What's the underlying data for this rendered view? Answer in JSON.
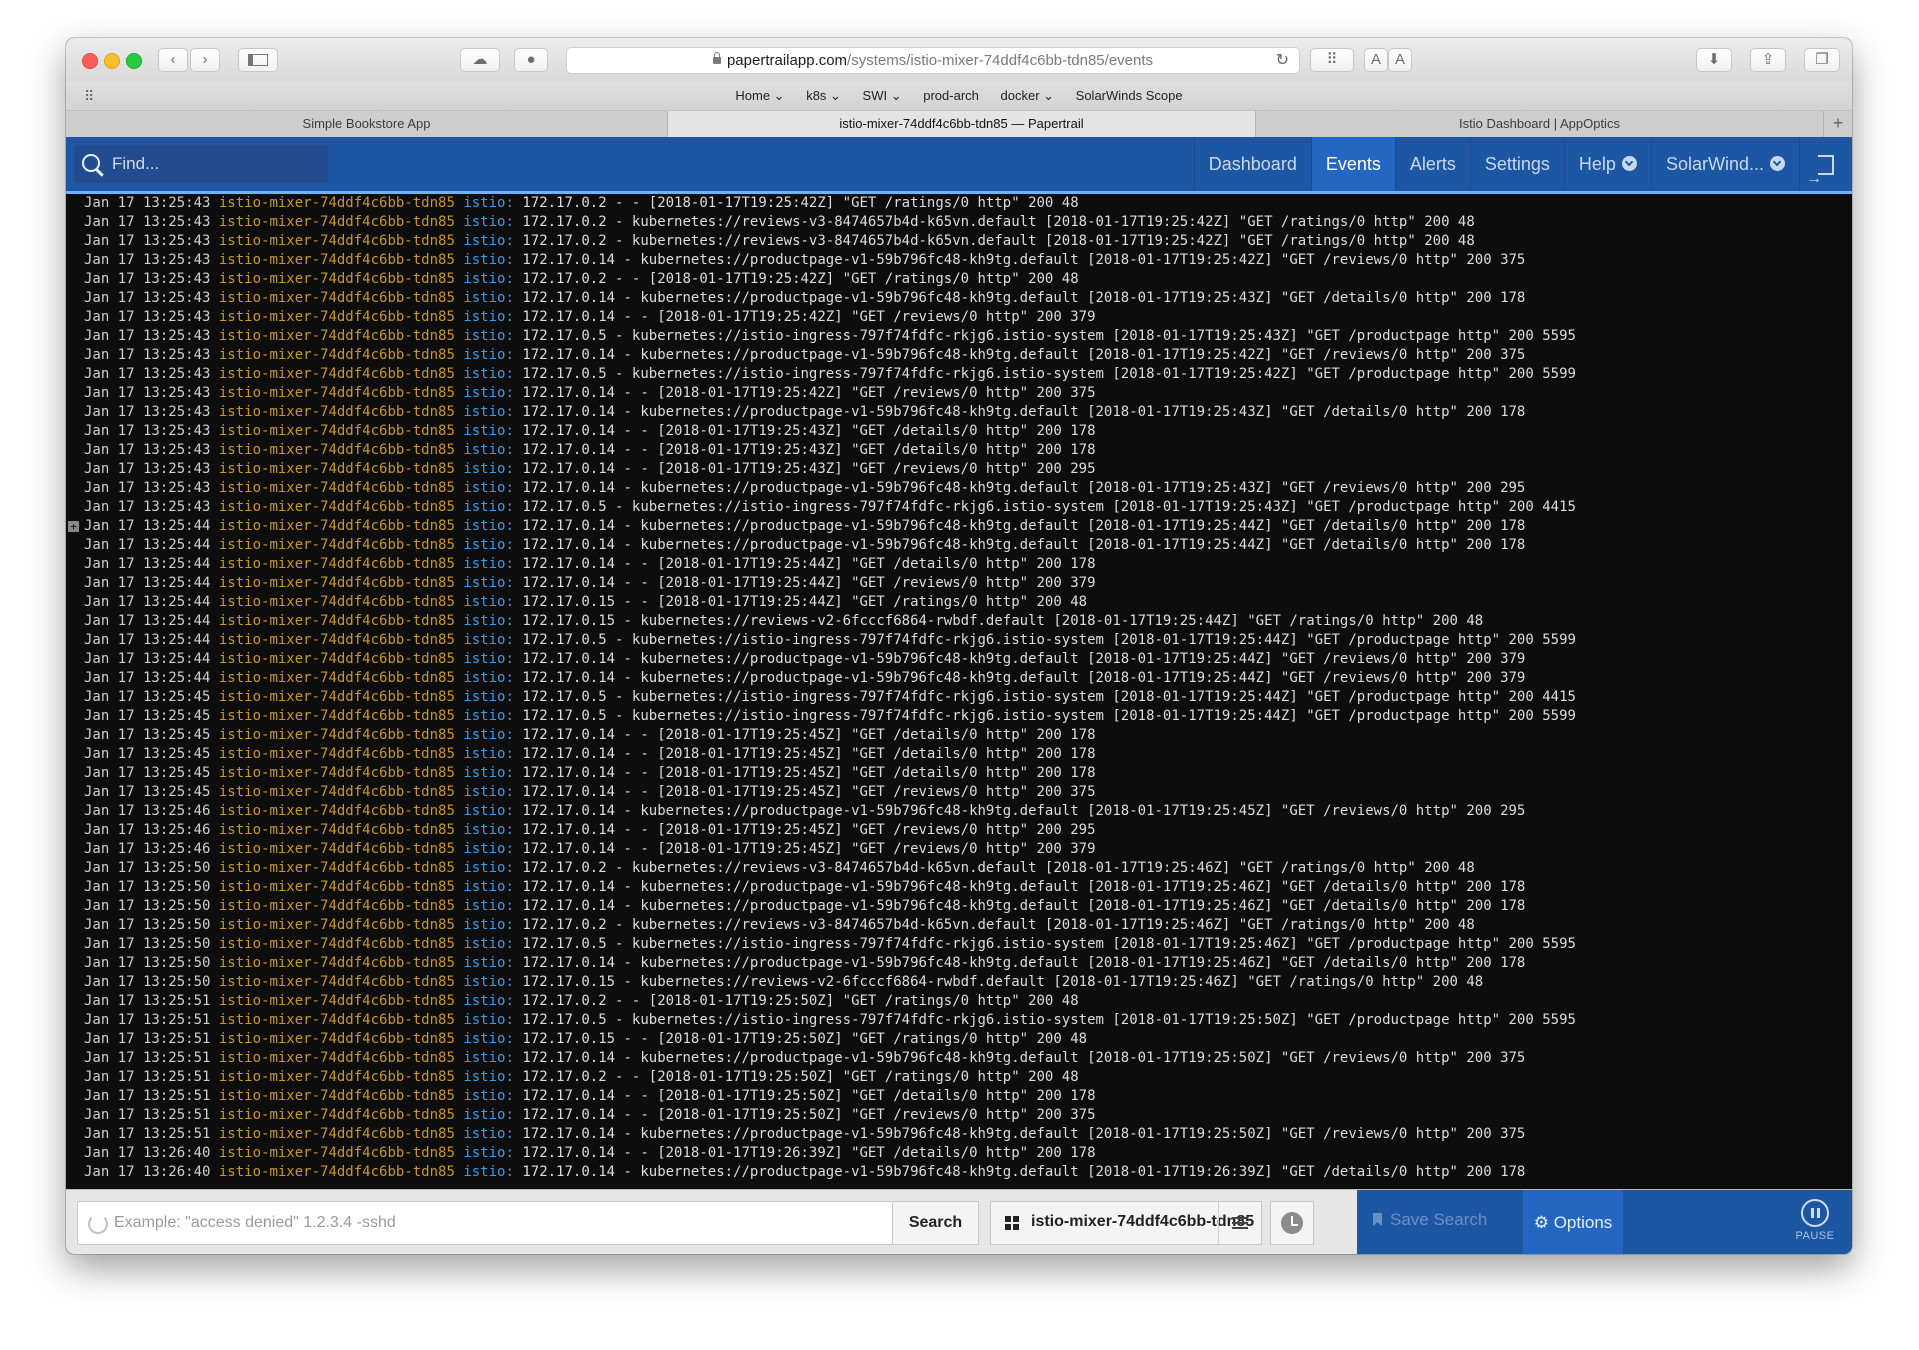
{
  "browser": {
    "url_host": "papertrailapp.com",
    "url_path": "/systems/istio-mixer-74ddf4c6bb-tdn85/events",
    "text_size_small": "A",
    "text_size_large": "A",
    "favorites": [
      "Home ⌄",
      "k8s ⌄",
      "SWI ⌄",
      "prod-arch",
      "docker ⌄",
      "SolarWinds Scope"
    ],
    "tabs": [
      {
        "title": "Simple Bookstore App",
        "active": false
      },
      {
        "title": "istio-mixer-74ddf4c6bb-tdn85 — Papertrail",
        "active": true
      },
      {
        "title": "Istio Dashboard | AppOptics",
        "active": false
      }
    ]
  },
  "nav": {
    "find_placeholder": "Find...",
    "items": [
      {
        "label": "Dashboard",
        "active": false
      },
      {
        "label": "Events",
        "active": true
      },
      {
        "label": "Alerts",
        "active": false
      },
      {
        "label": "Settings",
        "active": false
      },
      {
        "label": "Help",
        "active": false
      },
      {
        "label": "SolarWind...",
        "active": false
      }
    ]
  },
  "log": {
    "source": "istio-mixer-74ddf4c6bb-tdn85",
    "program": "istio:",
    "lines": [
      {
        "ts": "Jan 17 13:25:43",
        "msg": "172.17.0.2 - - [2018-01-17T19:25:42Z] \"GET /ratings/0 http\" 200 48"
      },
      {
        "ts": "Jan 17 13:25:43",
        "msg": "172.17.0.2 - kubernetes://reviews-v3-8474657b4d-k65vn.default [2018-01-17T19:25:42Z] \"GET /ratings/0 http\" 200 48"
      },
      {
        "ts": "Jan 17 13:25:43",
        "msg": "172.17.0.2 - kubernetes://reviews-v3-8474657b4d-k65vn.default [2018-01-17T19:25:42Z] \"GET /ratings/0 http\" 200 48"
      },
      {
        "ts": "Jan 17 13:25:43",
        "msg": "172.17.0.14 - kubernetes://productpage-v1-59b796fc48-kh9tg.default [2018-01-17T19:25:42Z] \"GET /reviews/0 http\" 200 375"
      },
      {
        "ts": "Jan 17 13:25:43",
        "msg": "172.17.0.2 - - [2018-01-17T19:25:42Z] \"GET /ratings/0 http\" 200 48"
      },
      {
        "ts": "Jan 17 13:25:43",
        "msg": "172.17.0.14 - kubernetes://productpage-v1-59b796fc48-kh9tg.default [2018-01-17T19:25:43Z] \"GET /details/0 http\" 200 178"
      },
      {
        "ts": "Jan 17 13:25:43",
        "msg": "172.17.0.14 - - [2018-01-17T19:25:42Z] \"GET /reviews/0 http\" 200 379"
      },
      {
        "ts": "Jan 17 13:25:43",
        "msg": "172.17.0.5 - kubernetes://istio-ingress-797f74fdfc-rkjg6.istio-system [2018-01-17T19:25:43Z] \"GET /productpage http\" 200 5595"
      },
      {
        "ts": "Jan 17 13:25:43",
        "msg": "172.17.0.14 - kubernetes://productpage-v1-59b796fc48-kh9tg.default [2018-01-17T19:25:42Z] \"GET /reviews/0 http\" 200 375"
      },
      {
        "ts": "Jan 17 13:25:43",
        "msg": "172.17.0.5 - kubernetes://istio-ingress-797f74fdfc-rkjg6.istio-system [2018-01-17T19:25:42Z] \"GET /productpage http\" 200 5599"
      },
      {
        "ts": "Jan 17 13:25:43",
        "msg": "172.17.0.14 - - [2018-01-17T19:25:42Z] \"GET /reviews/0 http\" 200 375"
      },
      {
        "ts": "Jan 17 13:25:43",
        "msg": "172.17.0.14 - kubernetes://productpage-v1-59b796fc48-kh9tg.default [2018-01-17T19:25:43Z] \"GET /details/0 http\" 200 178"
      },
      {
        "ts": "Jan 17 13:25:43",
        "msg": "172.17.0.14 - - [2018-01-17T19:25:43Z] \"GET /details/0 http\" 200 178"
      },
      {
        "ts": "Jan 17 13:25:43",
        "msg": "172.17.0.14 - - [2018-01-17T19:25:43Z] \"GET /details/0 http\" 200 178"
      },
      {
        "ts": "Jan 17 13:25:43",
        "msg": "172.17.0.14 - - [2018-01-17T19:25:43Z] \"GET /reviews/0 http\" 200 295"
      },
      {
        "ts": "Jan 17 13:25:43",
        "msg": "172.17.0.14 - kubernetes://productpage-v1-59b796fc48-kh9tg.default [2018-01-17T19:25:43Z] \"GET /reviews/0 http\" 200 295"
      },
      {
        "ts": "Jan 17 13:25:43",
        "msg": "172.17.0.5 - kubernetes://istio-ingress-797f74fdfc-rkjg6.istio-system [2018-01-17T19:25:43Z] \"GET /productpage http\" 200 4415"
      },
      {
        "ts": "Jan 17 13:25:44",
        "msg": "172.17.0.14 - kubernetes://productpage-v1-59b796fc48-kh9tg.default [2018-01-17T19:25:44Z] \"GET /details/0 http\" 200 178",
        "marker": "+"
      },
      {
        "ts": "Jan 17 13:25:44",
        "msg": "172.17.0.14 - kubernetes://productpage-v1-59b796fc48-kh9tg.default [2018-01-17T19:25:44Z] \"GET /details/0 http\" 200 178"
      },
      {
        "ts": "Jan 17 13:25:44",
        "msg": "172.17.0.14 - - [2018-01-17T19:25:44Z] \"GET /details/0 http\" 200 178"
      },
      {
        "ts": "Jan 17 13:25:44",
        "msg": "172.17.0.14 - - [2018-01-17T19:25:44Z] \"GET /reviews/0 http\" 200 379"
      },
      {
        "ts": "Jan 17 13:25:44",
        "msg": "172.17.0.15 - - [2018-01-17T19:25:44Z] \"GET /ratings/0 http\" 200 48"
      },
      {
        "ts": "Jan 17 13:25:44",
        "msg": "172.17.0.15 - kubernetes://reviews-v2-6fcccf6864-rwbdf.default [2018-01-17T19:25:44Z] \"GET /ratings/0 http\" 200 48"
      },
      {
        "ts": "Jan 17 13:25:44",
        "msg": "172.17.0.5 - kubernetes://istio-ingress-797f74fdfc-rkjg6.istio-system [2018-01-17T19:25:44Z] \"GET /productpage http\" 200 5599"
      },
      {
        "ts": "Jan 17 13:25:44",
        "msg": "172.17.0.14 - kubernetes://productpage-v1-59b796fc48-kh9tg.default [2018-01-17T19:25:44Z] \"GET /reviews/0 http\" 200 379"
      },
      {
        "ts": "Jan 17 13:25:44",
        "msg": "172.17.0.14 - kubernetes://productpage-v1-59b796fc48-kh9tg.default [2018-01-17T19:25:44Z] \"GET /reviews/0 http\" 200 379"
      },
      {
        "ts": "Jan 17 13:25:45",
        "msg": "172.17.0.5 - kubernetes://istio-ingress-797f74fdfc-rkjg6.istio-system [2018-01-17T19:25:44Z] \"GET /productpage http\" 200 4415"
      },
      {
        "ts": "Jan 17 13:25:45",
        "msg": "172.17.0.5 - kubernetes://istio-ingress-797f74fdfc-rkjg6.istio-system [2018-01-17T19:25:44Z] \"GET /productpage http\" 200 5599"
      },
      {
        "ts": "Jan 17 13:25:45",
        "msg": "172.17.0.14 - - [2018-01-17T19:25:45Z] \"GET /details/0 http\" 200 178"
      },
      {
        "ts": "Jan 17 13:25:45",
        "msg": "172.17.0.14 - - [2018-01-17T19:25:45Z] \"GET /details/0 http\" 200 178"
      },
      {
        "ts": "Jan 17 13:25:45",
        "msg": "172.17.0.14 - - [2018-01-17T19:25:45Z] \"GET /details/0 http\" 200 178"
      },
      {
        "ts": "Jan 17 13:25:45",
        "msg": "172.17.0.14 - - [2018-01-17T19:25:45Z] \"GET /reviews/0 http\" 200 375"
      },
      {
        "ts": "Jan 17 13:25:46",
        "msg": "172.17.0.14 - kubernetes://productpage-v1-59b796fc48-kh9tg.default [2018-01-17T19:25:45Z] \"GET /reviews/0 http\" 200 295"
      },
      {
        "ts": "Jan 17 13:25:46",
        "msg": "172.17.0.14 - - [2018-01-17T19:25:45Z] \"GET /reviews/0 http\" 200 295"
      },
      {
        "ts": "Jan 17 13:25:46",
        "msg": "172.17.0.14 - - [2018-01-17T19:25:45Z] \"GET /reviews/0 http\" 200 379"
      },
      {
        "ts": "Jan 17 13:25:50",
        "msg": "172.17.0.2 - kubernetes://reviews-v3-8474657b4d-k65vn.default [2018-01-17T19:25:46Z] \"GET /ratings/0 http\" 200 48"
      },
      {
        "ts": "Jan 17 13:25:50",
        "msg": "172.17.0.14 - kubernetes://productpage-v1-59b796fc48-kh9tg.default [2018-01-17T19:25:46Z] \"GET /details/0 http\" 200 178"
      },
      {
        "ts": "Jan 17 13:25:50",
        "msg": "172.17.0.14 - kubernetes://productpage-v1-59b796fc48-kh9tg.default [2018-01-17T19:25:46Z] \"GET /details/0 http\" 200 178"
      },
      {
        "ts": "Jan 17 13:25:50",
        "msg": "172.17.0.2 - kubernetes://reviews-v3-8474657b4d-k65vn.default [2018-01-17T19:25:46Z] \"GET /ratings/0 http\" 200 48"
      },
      {
        "ts": "Jan 17 13:25:50",
        "msg": "172.17.0.5 - kubernetes://istio-ingress-797f74fdfc-rkjg6.istio-system [2018-01-17T19:25:46Z] \"GET /productpage http\" 200 5595"
      },
      {
        "ts": "Jan 17 13:25:50",
        "msg": "172.17.0.14 - kubernetes://productpage-v1-59b796fc48-kh9tg.default [2018-01-17T19:25:46Z] \"GET /details/0 http\" 200 178"
      },
      {
        "ts": "Jan 17 13:25:50",
        "msg": "172.17.0.15 - kubernetes://reviews-v2-6fcccf6864-rwbdf.default [2018-01-17T19:25:46Z] \"GET /ratings/0 http\" 200 48"
      },
      {
        "ts": "Jan 17 13:25:51",
        "msg": "172.17.0.2 - - [2018-01-17T19:25:50Z] \"GET /ratings/0 http\" 200 48"
      },
      {
        "ts": "Jan 17 13:25:51",
        "msg": "172.17.0.5 - kubernetes://istio-ingress-797f74fdfc-rkjg6.istio-system [2018-01-17T19:25:50Z] \"GET /productpage http\" 200 5595"
      },
      {
        "ts": "Jan 17 13:25:51",
        "msg": "172.17.0.15 - - [2018-01-17T19:25:50Z] \"GET /ratings/0 http\" 200 48"
      },
      {
        "ts": "Jan 17 13:25:51",
        "msg": "172.17.0.14 - kubernetes://productpage-v1-59b796fc48-kh9tg.default [2018-01-17T19:25:50Z] \"GET /reviews/0 http\" 200 375"
      },
      {
        "ts": "Jan 17 13:25:51",
        "msg": "172.17.0.2 - - [2018-01-17T19:25:50Z] \"GET /ratings/0 http\" 200 48"
      },
      {
        "ts": "Jan 17 13:25:51",
        "msg": "172.17.0.14 - - [2018-01-17T19:25:50Z] \"GET /details/0 http\" 200 178"
      },
      {
        "ts": "Jan 17 13:25:51",
        "msg": "172.17.0.14 - - [2018-01-17T19:25:50Z] \"GET /reviews/0 http\" 200 375"
      },
      {
        "ts": "Jan 17 13:25:51",
        "msg": "172.17.0.14 - kubernetes://productpage-v1-59b796fc48-kh9tg.default [2018-01-17T19:25:50Z] \"GET /reviews/0 http\" 200 375"
      },
      {
        "ts": "Jan 17 13:26:40",
        "msg": "172.17.0.14 - - [2018-01-17T19:26:39Z] \"GET /details/0 http\" 200 178"
      },
      {
        "ts": "Jan 17 13:26:40",
        "msg": "172.17.0.14 - kubernetes://productpage-v1-59b796fc48-kh9tg.default [2018-01-17T19:26:39Z] \"GET /details/0 http\" 200 178"
      }
    ]
  },
  "search": {
    "placeholder": "Example: \"access denied\" 1.2.3.4 -sshd",
    "button_label": "Search",
    "group_name": "istio-mixer-74ddf4c6bb-tdn85",
    "save_label": "Save Search",
    "options_label": "Options",
    "pause_label": "PAUSE"
  },
  "colors": {
    "nav_blue": "#1d56a2",
    "nav_active": "#2367c2",
    "log_bg": "#0d0d0d",
    "source_color": "#c99824",
    "program_color": "#3d9be6"
  }
}
